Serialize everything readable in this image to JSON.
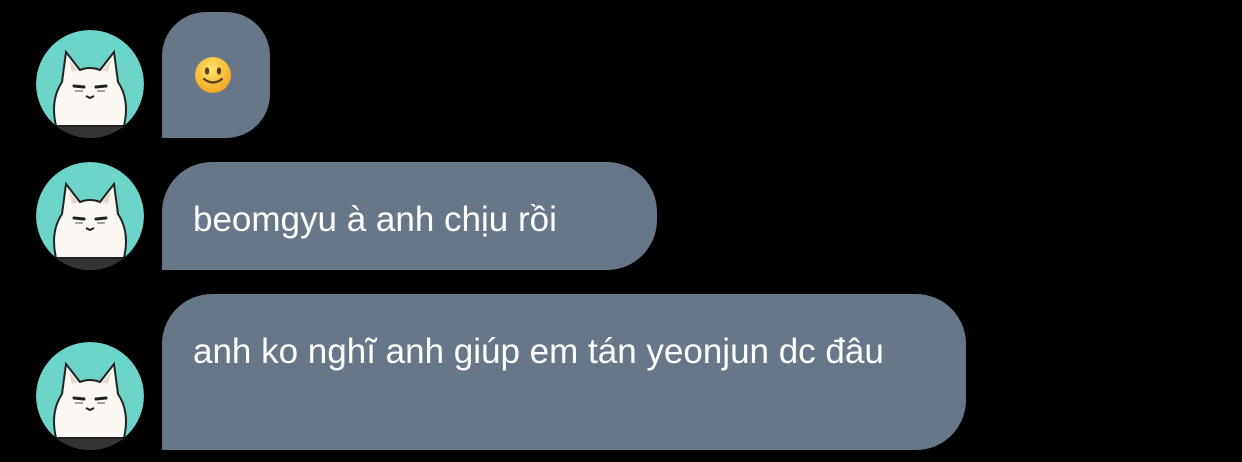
{
  "chat": {
    "messages": [
      {
        "text": "",
        "emoji": "slightly-smiling-face-icon"
      },
      {
        "text": "beomgyu à anh chịu rồi"
      },
      {
        "text": "anh ko nghĩ anh giúp em tán yeonjun dc đâu"
      }
    ]
  },
  "colors": {
    "background": "#000000",
    "bubble": "#677787",
    "avatar_bg": "#6dd5c8",
    "text": "#ffffff"
  },
  "icons": {
    "avatar": "white-cat-avatar-icon"
  }
}
